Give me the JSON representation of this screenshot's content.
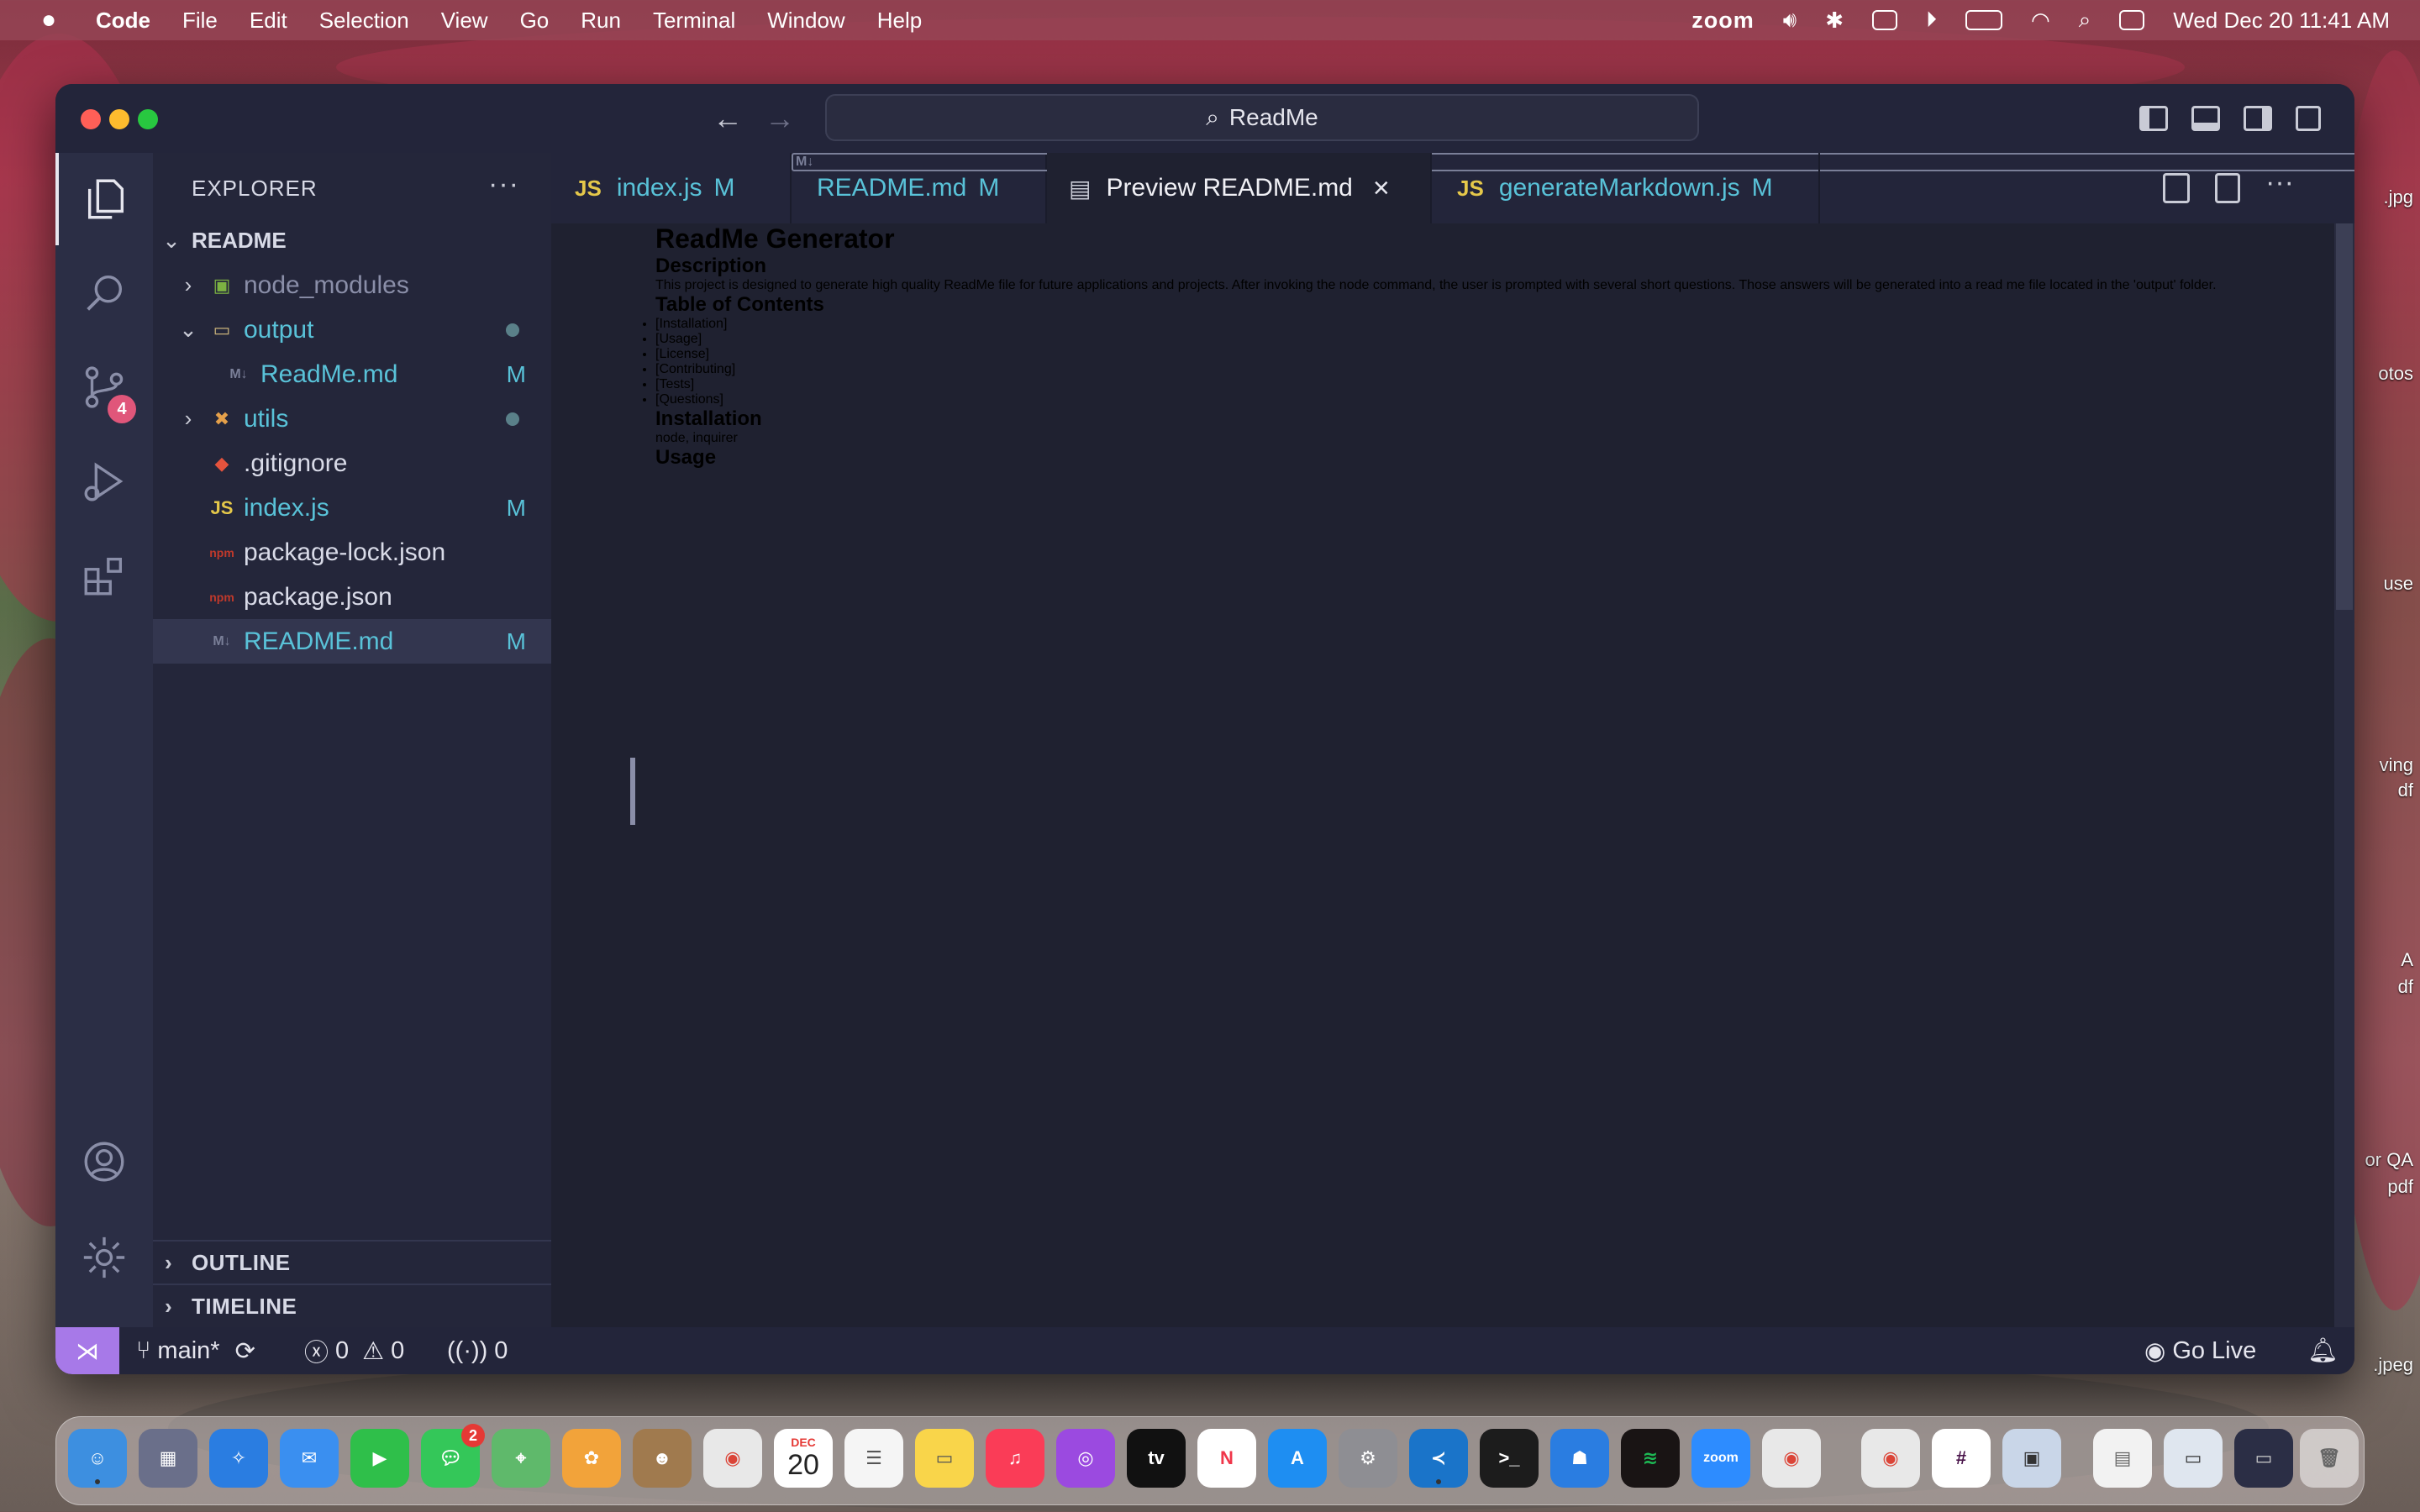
{
  "menubar": {
    "app": "Code",
    "items": [
      "File",
      "Edit",
      "Selection",
      "View",
      "Go",
      "Run",
      "Terminal",
      "Window",
      "Help"
    ],
    "zoom_label": "zoom",
    "clock": "Wed Dec 20  11:41 AM"
  },
  "desktop_labels": [
    ".jpg",
    "otos",
    "use",
    "ving",
    "df",
    "A",
    "df",
    "or QA",
    "pdf",
    ".jpeg"
  ],
  "window": {
    "command_center": "ReadMe"
  },
  "activity": {
    "scm_badge": "4"
  },
  "explorer": {
    "title": "EXPLORER",
    "more": "···",
    "root": "README",
    "items": [
      {
        "name": "node_modules",
        "type": "folder",
        "expanded": false,
        "status": ""
      },
      {
        "name": "output",
        "type": "folder",
        "expanded": true,
        "status": "dot"
      },
      {
        "name": "ReadMe.md",
        "type": "md",
        "status": "M"
      },
      {
        "name": "utils",
        "type": "folder",
        "expanded": false,
        "status": "dot"
      },
      {
        "name": ".gitignore",
        "type": "git",
        "status": ""
      },
      {
        "name": "index.js",
        "type": "js",
        "status": "M"
      },
      {
        "name": "package-lock.json",
        "type": "json",
        "status": ""
      },
      {
        "name": "package.json",
        "type": "json",
        "status": ""
      },
      {
        "name": "README.md",
        "type": "md",
        "status": "M"
      }
    ],
    "outline": "OUTLINE",
    "timeline": "TIMELINE"
  },
  "tabs": [
    {
      "icon": "JS",
      "label": "index.js",
      "mod": "M",
      "active": false
    },
    {
      "icon": "M↓",
      "label": "README.md",
      "mod": "M",
      "active": false
    },
    {
      "icon": "preview",
      "label": "Preview README.md",
      "mod": "",
      "active": true
    },
    {
      "icon": "JS",
      "label": "generateMarkdown.js",
      "mod": "M",
      "active": false
    }
  ],
  "preview": {
    "h1": "ReadMe Generator",
    "description_heading": "Description",
    "description": "This project is designed to generate high quality ReadMe file for future applications and projects. After invoking the node command, the user is prompted with several short questions. Those answers will be generated into a read me file located in the 'output' folder.",
    "toc_heading": "Table of Contents",
    "toc": [
      "[Installation]",
      "[Usage]",
      "[License]",
      "[Contributing]",
      "[Tests]",
      "[Questions]"
    ],
    "installation_heading": "Installation",
    "installation": "node, inquirer",
    "usage_heading": "Usage"
  },
  "status": {
    "branch": "main*",
    "errors": "0",
    "warnings": "0",
    "ports": "0",
    "golive": "Go Live"
  },
  "dock": {
    "calendar_month": "DEC",
    "calendar_day": "20",
    "messages_badge": "2",
    "zoom_label": "zoom",
    "tv_label": "tv"
  }
}
